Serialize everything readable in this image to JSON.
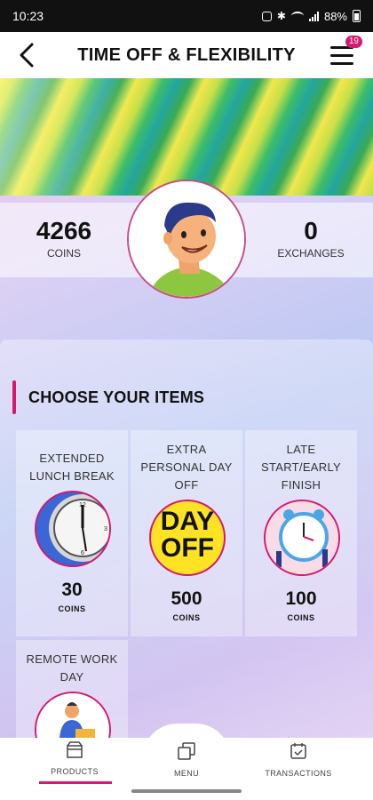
{
  "status_bar": {
    "time": "10:23",
    "battery": "88%"
  },
  "header": {
    "title": "TIME OFF & FLEXIBILITY",
    "menu_badge": "19"
  },
  "stats": {
    "coins_value": "4266",
    "coins_label": "COINS",
    "exchanges_value": "0",
    "exchanges_label": "EXCHANGES"
  },
  "section": {
    "title": "CHOOSE YOUR ITEMS"
  },
  "items": [
    {
      "name_line1": "EXTENDED",
      "name_line2": "LUNCH BREAK",
      "name_line3": "",
      "price": "30",
      "unit": "COINS",
      "image_icon": "clock-icon"
    },
    {
      "name_line1": "EXTRA",
      "name_line2": "PERSONAL DAY",
      "name_line3": "OFF",
      "price": "500",
      "unit": "COINS",
      "image_icon": "day-off-icon",
      "image_text_1": "DAY",
      "image_text_2": "OFF"
    },
    {
      "name_line1": "LATE",
      "name_line2": "START/EARLY",
      "name_line3": "FINISH",
      "price": "100",
      "unit": "COINS",
      "image_icon": "alarm-clock-icon"
    },
    {
      "name_line1": "REMOTE WORK",
      "name_line2": "DAY",
      "name_line3": "",
      "image_icon": "laptop-person-icon"
    }
  ],
  "nav": {
    "products": "PRODUCTS",
    "menu": "MENU",
    "transactions": "TRANSACTIONS"
  },
  "colors": {
    "accent": "#d6186f",
    "header_bg": "#ffffff",
    "status_bar_bg": "#111111"
  }
}
